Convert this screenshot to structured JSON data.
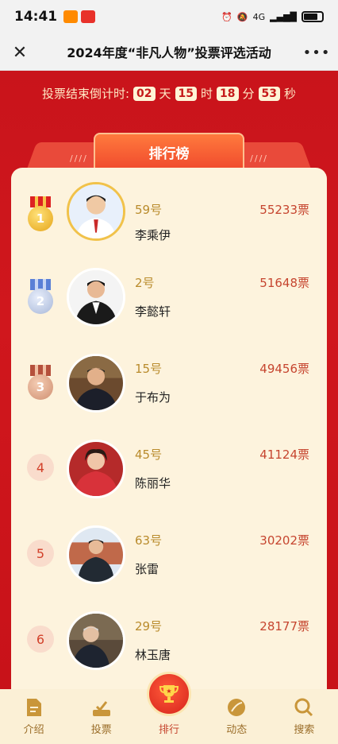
{
  "status_bar": {
    "time": "14:41",
    "network": "4G"
  },
  "title_bar": {
    "title": "2024年度“非凡人物”投票评选活动",
    "close_icon": "close-icon",
    "more_icon": "more-icon"
  },
  "countdown": {
    "label": "投票结束倒计时:",
    "days": "02",
    "days_unit": "天",
    "hours": "15",
    "hours_unit": "时",
    "minutes": "18",
    "minutes_unit": "分",
    "seconds": "53",
    "seconds_unit": "秒"
  },
  "ranking": {
    "tab_title": "排行榜",
    "wing_marks": "////",
    "items": [
      {
        "rank": "1",
        "number": "59号",
        "name": "李乘伊",
        "votes": "55233票"
      },
      {
        "rank": "2",
        "number": "2号",
        "name": "李懿轩",
        "votes": "51648票"
      },
      {
        "rank": "3",
        "number": "15号",
        "name": "于布为",
        "votes": "49456票"
      },
      {
        "rank": "4",
        "number": "45号",
        "name": "陈丽华",
        "votes": "41124票"
      },
      {
        "rank": "5",
        "number": "63号",
        "name": "张雷",
        "votes": "30202票"
      },
      {
        "rank": "6",
        "number": "29号",
        "name": "林玉唐",
        "votes": "28177票"
      }
    ]
  },
  "bottom_nav": {
    "items": [
      {
        "label": "介绍",
        "icon": "document-icon"
      },
      {
        "label": "投票",
        "icon": "ballot-icon"
      },
      {
        "label": "排行",
        "icon": "trophy-icon"
      },
      {
        "label": "动态",
        "icon": "leaf-icon"
      },
      {
        "label": "搜索",
        "icon": "search-icon"
      }
    ]
  },
  "colors": {
    "primary_red": "#c9141b",
    "card_bg": "#fdf3dd",
    "vote_text": "#c6452f",
    "gold": "#f1c24a"
  }
}
